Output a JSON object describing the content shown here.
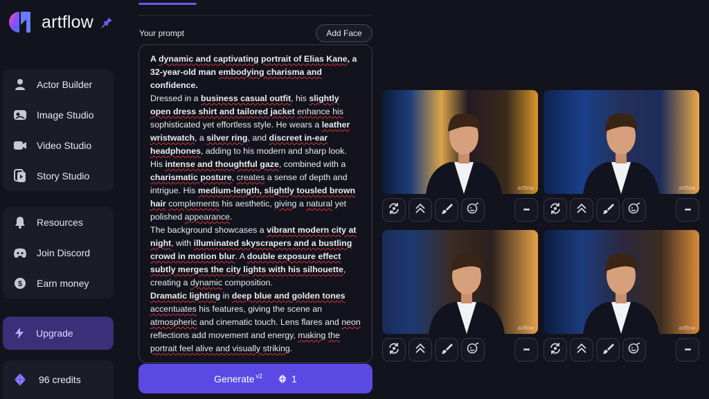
{
  "app": {
    "name": "artflow"
  },
  "sidebar": {
    "groups": [
      [
        {
          "label": "Actor Builder",
          "icon": "person-icon"
        },
        {
          "label": "Image Studio",
          "icon": "image-studio-icon"
        },
        {
          "label": "Video Studio",
          "icon": "video-camera-icon"
        },
        {
          "label": "Story Studio",
          "icon": "story-icon"
        }
      ],
      [
        {
          "label": "Resources",
          "icon": "bell-icon"
        },
        {
          "label": "Join Discord",
          "icon": "discord-icon"
        },
        {
          "label": "Earn money",
          "icon": "dollar-icon"
        }
      ]
    ],
    "upgrade_label": "Upgrade",
    "credits_label": "96 credits"
  },
  "prompt": {
    "label": "Your prompt",
    "add_face_label": "Add Face",
    "paragraphs": [
      [
        {
          "t": "A ",
          "b": true
        },
        {
          "t": "dynamic and captivating",
          "b": true,
          "s": true
        },
        {
          "t": " ",
          "b": true
        },
        {
          "t": "portrait of Elias Kane",
          "b": true,
          "s": true
        },
        {
          "t": ", a 32-year-old man ",
          "b": true
        },
        {
          "t": "embodying charisma and",
          "b": true,
          "s": true
        },
        {
          "t": " confidence.",
          "b": true
        }
      ],
      [
        {
          "t": "Dressed in a "
        },
        {
          "t": "business casual outfit",
          "b": true,
          "s": true
        },
        {
          "t": ", his "
        },
        {
          "t": "slightly open dress shirt and tailored jacket",
          "b": true,
          "s": true
        },
        {
          "t": " "
        },
        {
          "t": "enhance his",
          "s": true
        },
        {
          "t": " sophisticated yet effortless style. He wears a "
        },
        {
          "t": "leather wristwatch",
          "b": true,
          "s": true
        },
        {
          "t": ", a "
        },
        {
          "t": "silver ring",
          "b": true,
          "s": true
        },
        {
          "t": ", and "
        },
        {
          "t": "discreet in-ear headphones",
          "b": true,
          "s": true
        },
        {
          "t": ", adding to his modern and sharp look."
        }
      ],
      [
        {
          "t": "His "
        },
        {
          "t": "intense and thoughtful gaze",
          "b": true,
          "s": true
        },
        {
          "t": ", combined with a "
        },
        {
          "t": "charismatic posture",
          "b": true,
          "s": true
        },
        {
          "t": ", "
        },
        {
          "t": "creates",
          "s": true
        },
        {
          "t": " a sense of depth and intrigue. His "
        },
        {
          "t": "medium-length, slightly tousled brown hair",
          "b": true,
          "s": true
        },
        {
          "t": " "
        },
        {
          "t": "complements",
          "s": true
        },
        {
          "t": " his aesthetic, "
        },
        {
          "t": "giving",
          "s": true
        },
        {
          "t": " a "
        },
        {
          "t": "natural",
          "s": true
        },
        {
          "t": " yet polished "
        },
        {
          "t": "appearance",
          "s": true
        },
        {
          "t": "."
        }
      ],
      [
        {
          "t": "The background showcases a "
        },
        {
          "t": "vibrant modern city at night",
          "b": true,
          "s": true
        },
        {
          "t": ", with "
        },
        {
          "t": "illuminated skyscrapers and a bustling crowd in motion blur",
          "b": true,
          "s": true
        },
        {
          "t": ". A "
        },
        {
          "t": "double exposure effect subtly merges the city lights with his silhouette",
          "b": true,
          "s": true
        },
        {
          "t": ", creating a "
        },
        {
          "t": "dynamic",
          "s": true
        },
        {
          "t": " composition."
        }
      ],
      [
        {
          "t": "Dramatic lighting",
          "b": true,
          "s": true
        },
        {
          "t": " in "
        },
        {
          "t": "deep blue and golden tones",
          "b": true,
          "s": true
        },
        {
          "t": " "
        },
        {
          "t": "accentuates",
          "s": true
        },
        {
          "t": " his features, giving the scene an "
        },
        {
          "t": "atmospheric",
          "s": true
        },
        {
          "t": " and cinematic touch. Lens flares and "
        },
        {
          "t": "neon",
          "s": true
        },
        {
          "t": " reflections add movement and energy, "
        },
        {
          "t": "making",
          "s": true
        },
        {
          "t": " "
        },
        {
          "t": "the portrait feel alive and visually striking",
          "s": true
        },
        {
          "t": "."
        }
      ]
    ]
  },
  "generate": {
    "label": "Generate",
    "version": "v2",
    "cost": "1"
  },
  "images": {
    "watermark": "artflow",
    "more_label": "•••"
  },
  "colors": {
    "accent": "#5b49e3",
    "upgrade_bg": "#3a2f78"
  }
}
